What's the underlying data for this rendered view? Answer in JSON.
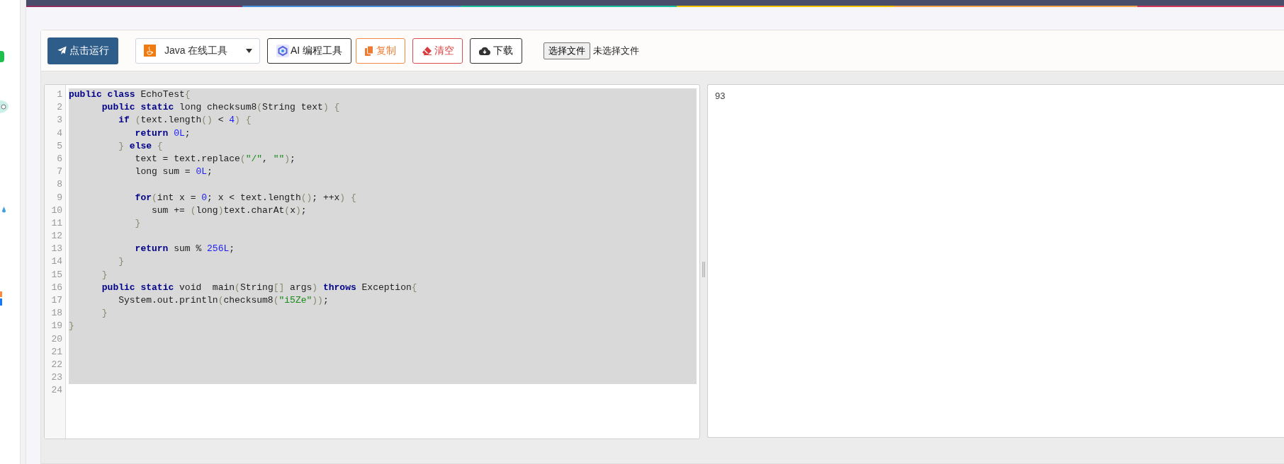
{
  "toolbar": {
    "run_button": "点击运行",
    "language_select": "Java 在线工具",
    "ai_button": "AI 编程工具",
    "copy_button": "复制",
    "clear_button": "清空",
    "download_button": "下载",
    "file_button": "选择文件",
    "file_status": "未选择文件"
  },
  "editor": {
    "lines": [
      {
        "number": "1",
        "selected": true,
        "tokens": [
          {
            "kind": "keyword",
            "text": "public "
          },
          {
            "kind": "keyword",
            "text": "class"
          },
          {
            "kind": "plain",
            "text": " EchoTest"
          },
          {
            "kind": "bracket",
            "text": "{"
          }
        ]
      },
      {
        "number": "2",
        "selected": true,
        "tokens": [
          {
            "kind": "keyword",
            "text": "      public "
          },
          {
            "kind": "keyword",
            "text": "static"
          },
          {
            "kind": "plain",
            "text": " long checksum8"
          },
          {
            "kind": "bracket",
            "text": "("
          },
          {
            "kind": "plain",
            "text": "String text"
          },
          {
            "kind": "bracket",
            "text": ") {"
          }
        ]
      },
      {
        "number": "3",
        "selected": true,
        "tokens": [
          {
            "kind": "keyword",
            "text": "         if "
          },
          {
            "kind": "bracket",
            "text": "("
          },
          {
            "kind": "plain",
            "text": "text.length"
          },
          {
            "kind": "bracket",
            "text": "()"
          },
          {
            "kind": "plain",
            "text": " < "
          },
          {
            "kind": "number",
            "text": "4"
          },
          {
            "kind": "bracket",
            "text": ") {"
          }
        ]
      },
      {
        "number": "4",
        "selected": true,
        "tokens": [
          {
            "kind": "keyword",
            "text": "            return "
          },
          {
            "kind": "number",
            "text": "0L"
          },
          {
            "kind": "plain",
            "text": ";"
          }
        ]
      },
      {
        "number": "5",
        "selected": true,
        "tokens": [
          {
            "kind": "bracket",
            "text": "         } "
          },
          {
            "kind": "keyword",
            "text": "else "
          },
          {
            "kind": "bracket",
            "text": "{"
          }
        ]
      },
      {
        "number": "6",
        "selected": true,
        "tokens": [
          {
            "kind": "plain",
            "text": "            text = text.replace"
          },
          {
            "kind": "bracket",
            "text": "("
          },
          {
            "kind": "string",
            "text": "\"/\""
          },
          {
            "kind": "plain",
            "text": ", "
          },
          {
            "kind": "string",
            "text": "\"\""
          },
          {
            "kind": "bracket",
            "text": ")"
          },
          {
            "kind": "plain",
            "text": ";"
          }
        ]
      },
      {
        "number": "7",
        "selected": true,
        "tokens": [
          {
            "kind": "plain",
            "text": "            long sum = "
          },
          {
            "kind": "number",
            "text": "0L"
          },
          {
            "kind": "plain",
            "text": ";"
          }
        ]
      },
      {
        "number": "8",
        "selected": true
      },
      {
        "number": "9",
        "selected": true,
        "tokens": [
          {
            "kind": "keyword",
            "text": "            for"
          },
          {
            "kind": "bracket",
            "text": "("
          },
          {
            "kind": "plain",
            "text": "int x = "
          },
          {
            "kind": "number",
            "text": "0"
          },
          {
            "kind": "plain",
            "text": "; x < text.length"
          },
          {
            "kind": "bracket",
            "text": "()"
          },
          {
            "kind": "plain",
            "text": "; ++x"
          },
          {
            "kind": "bracket",
            "text": ") {"
          }
        ]
      },
      {
        "number": "10",
        "selected": true,
        "tokens": [
          {
            "kind": "plain",
            "text": "               sum += "
          },
          {
            "kind": "bracket",
            "text": "("
          },
          {
            "kind": "plain",
            "text": "long"
          },
          {
            "kind": "bracket",
            "text": ")"
          },
          {
            "kind": "plain",
            "text": "text.charAt"
          },
          {
            "kind": "bracket",
            "text": "("
          },
          {
            "kind": "plain",
            "text": "x"
          },
          {
            "kind": "bracket",
            "text": ")"
          },
          {
            "kind": "plain",
            "text": ";"
          }
        ]
      },
      {
        "number": "11",
        "selected": true,
        "tokens": [
          {
            "kind": "bracket",
            "text": "            }"
          }
        ]
      },
      {
        "number": "12",
        "selected": true
      },
      {
        "number": "13",
        "selected": true,
        "tokens": [
          {
            "kind": "keyword",
            "text": "            return"
          },
          {
            "kind": "plain",
            "text": " sum % "
          },
          {
            "kind": "number",
            "text": "256L"
          },
          {
            "kind": "plain",
            "text": ";"
          }
        ]
      },
      {
        "number": "14",
        "selected": true,
        "tokens": [
          {
            "kind": "bracket",
            "text": "         }"
          }
        ]
      },
      {
        "number": "15",
        "selected": true,
        "tokens": [
          {
            "kind": "bracket",
            "text": "      }"
          }
        ]
      },
      {
        "number": "16",
        "selected": true,
        "tokens": [
          {
            "kind": "keyword",
            "text": "      public "
          },
          {
            "kind": "keyword",
            "text": "static"
          },
          {
            "kind": "plain",
            "text": " void  main"
          },
          {
            "kind": "bracket",
            "text": "("
          },
          {
            "kind": "plain",
            "text": "String"
          },
          {
            "kind": "bracket",
            "text": "[]"
          },
          {
            "kind": "plain",
            "text": " args"
          },
          {
            "kind": "bracket",
            "text": ") "
          },
          {
            "kind": "keyword",
            "text": "throws"
          },
          {
            "kind": "plain",
            "text": " Exception"
          },
          {
            "kind": "bracket",
            "text": "{"
          }
        ]
      },
      {
        "number": "17",
        "selected": true,
        "tokens": [
          {
            "kind": "plain",
            "text": "         System.out.println"
          },
          {
            "kind": "bracket",
            "text": "("
          },
          {
            "kind": "plain",
            "text": "checksum8"
          },
          {
            "kind": "bracket",
            "text": "("
          },
          {
            "kind": "string",
            "text": "\"i5Ze\""
          },
          {
            "kind": "bracket",
            "text": "))"
          },
          {
            "kind": "plain",
            "text": ";"
          }
        ]
      },
      {
        "number": "18",
        "selected": true,
        "tokens": [
          {
            "kind": "bracket",
            "text": "      }"
          }
        ]
      },
      {
        "number": "19",
        "selected": true,
        "tokens": [
          {
            "kind": "bracket",
            "text": "}"
          }
        ]
      },
      {
        "number": "20",
        "selected": true
      },
      {
        "number": "21",
        "selected": true
      },
      {
        "number": "22",
        "selected": true
      },
      {
        "number": "23",
        "selected": true
      },
      {
        "number": "24",
        "selected": false
      }
    ]
  },
  "output": {
    "text": "93"
  }
}
